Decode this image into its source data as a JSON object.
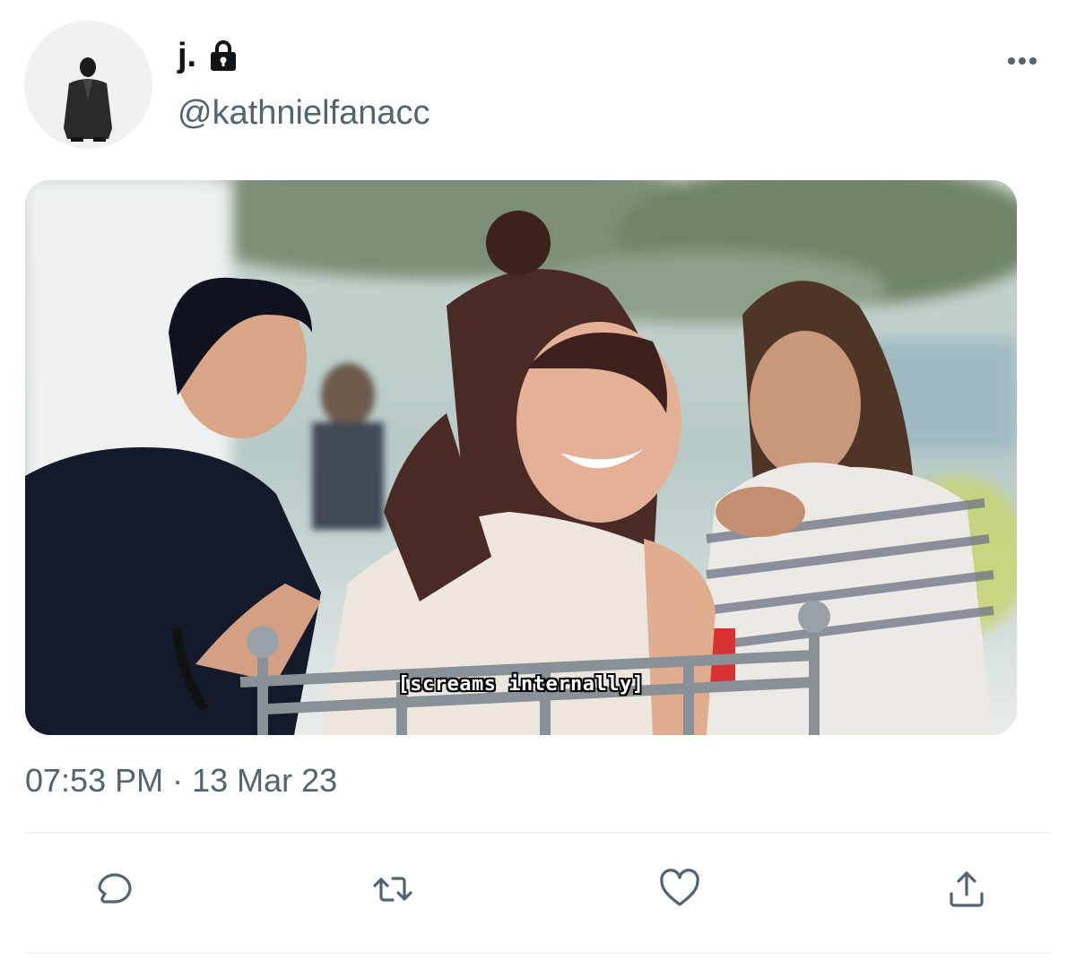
{
  "tweet": {
    "display_name": "j.",
    "handle": "@kathnielfanacc",
    "timestamp": "07:53 PM · 13 Mar 23",
    "media_caption": "[screams internally]"
  },
  "icons": {
    "protected": "lock-icon",
    "more": "more-icon",
    "reply": "reply-icon",
    "retweet": "retweet-icon",
    "like": "like-icon",
    "share": "share-icon"
  },
  "colors": {
    "text": "#0f1419",
    "secondary": "#536471",
    "divider": "#eff3f4"
  }
}
